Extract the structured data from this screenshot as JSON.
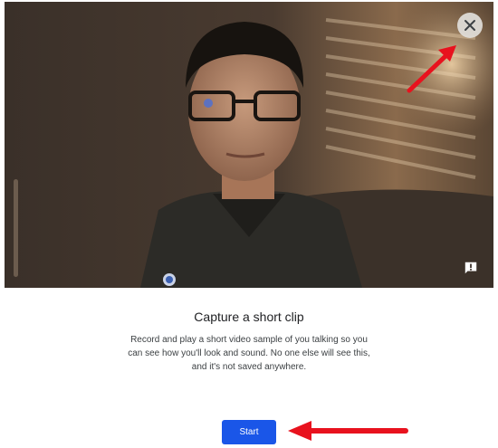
{
  "dialog": {
    "title": "Capture a short clip",
    "description": "Record and play a short video sample of you talking so you can see how you'll look and sound. No one else will see this, and it's not saved anywhere.",
    "start_label": "Start"
  },
  "icons": {
    "close": "close-icon",
    "feedback": "feedback-icon",
    "mic_level": "mic-level-meter"
  },
  "colors": {
    "primary": "#1a56e8",
    "annotation_arrow": "#e8121e"
  }
}
